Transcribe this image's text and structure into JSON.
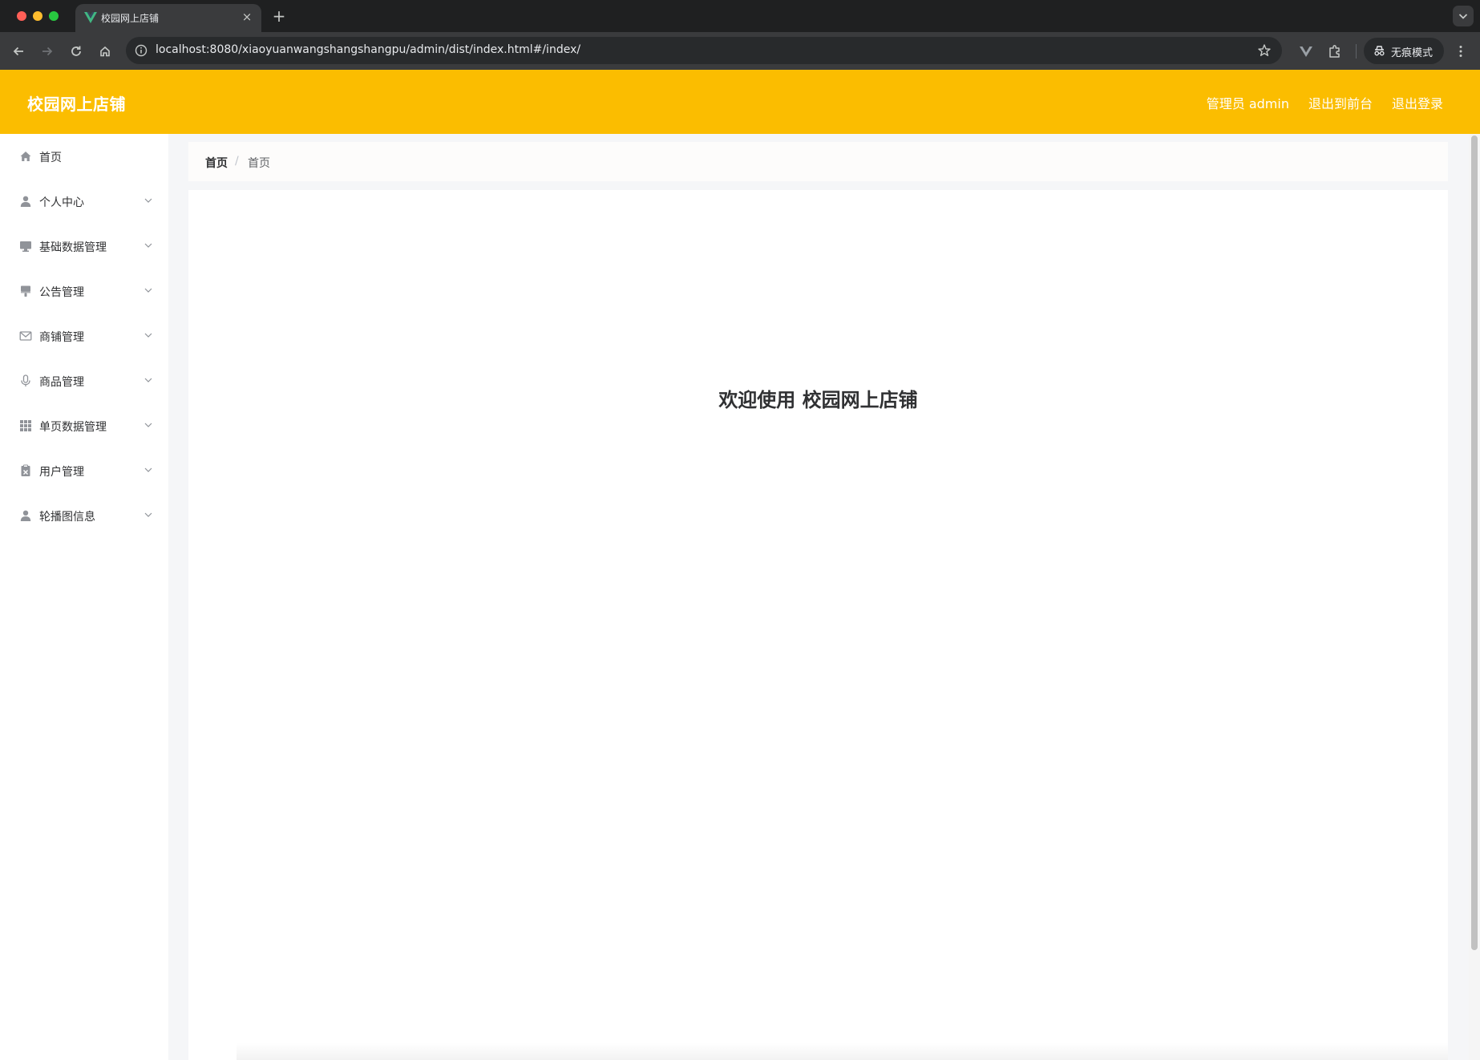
{
  "browser": {
    "tab_title": "校园网上店铺",
    "new_tab_symbol": "+",
    "close_symbol": "×",
    "url": "localhost:8080/xiaoyuanwangshangshangpu/admin/dist/index.html#/index/",
    "incognito_label": "无痕模式"
  },
  "header": {
    "brand": "校园网上店铺",
    "user_label": "管理员 admin",
    "to_front_label": "退出到前台",
    "logout_label": "退出登录",
    "background_color": "#fbbd00"
  },
  "sidebar": {
    "items": [
      {
        "label": "首页",
        "icon": "home-icon",
        "expandable": false
      },
      {
        "label": "个人中心",
        "icon": "user-icon",
        "expandable": true
      },
      {
        "label": "基础数据管理",
        "icon": "monitor-icon",
        "expandable": true
      },
      {
        "label": "公告管理",
        "icon": "brush-icon",
        "expandable": true
      },
      {
        "label": "商铺管理",
        "icon": "envelope-icon",
        "expandable": true
      },
      {
        "label": "商品管理",
        "icon": "microphone-icon",
        "expandable": true
      },
      {
        "label": "单页数据管理",
        "icon": "grid-icon",
        "expandable": true
      },
      {
        "label": "用户管理",
        "icon": "clipboard-icon",
        "expandable": true
      },
      {
        "label": "轮播图信息",
        "icon": "user-icon",
        "expandable": true
      }
    ]
  },
  "breadcrumb": {
    "items": [
      "首页",
      "首页"
    ],
    "separator": "/"
  },
  "main": {
    "welcome_text": "欢迎使用 校园网上店铺"
  }
}
